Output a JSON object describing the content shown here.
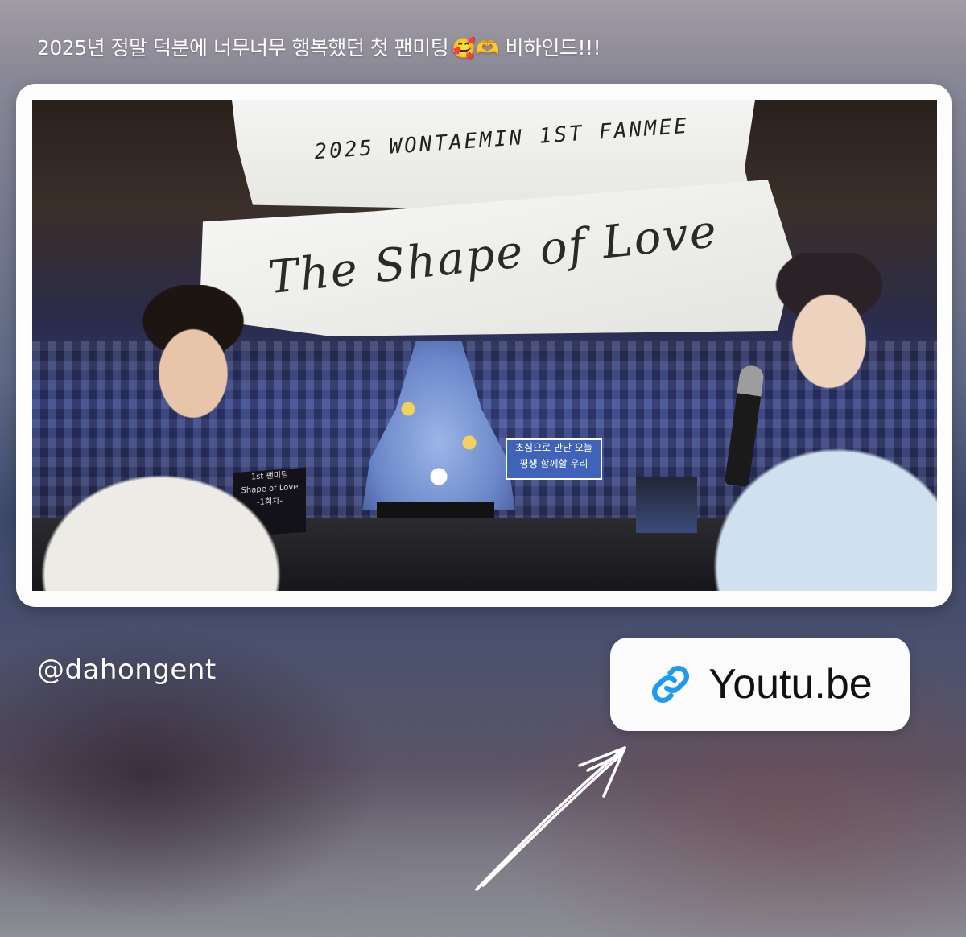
{
  "story": {
    "caption": "2025년 정말 덕분에 너무너무 행복했던 첫 팬미팅",
    "caption_emojis": "🥰🫶",
    "caption_suffix": " 비하인드!!!",
    "mention": "@dahongent",
    "link_sticker": {
      "label": "Youtu.be",
      "icon": "link-icon",
      "accent": "#1d9bf0"
    },
    "photo": {
      "paper_line_1": "2025 WONTAEMIN 1ST FANMEE",
      "paper_line_2": "The Shape of Love",
      "fan_sign_line_1": "초심으로 만난 오늘",
      "fan_sign_line_2": "평생 함께할 우리",
      "screen_line_1": "1st 팬미팅",
      "screen_line_2": "Shape of Love",
      "screen_line_3": "-1회차-"
    }
  }
}
